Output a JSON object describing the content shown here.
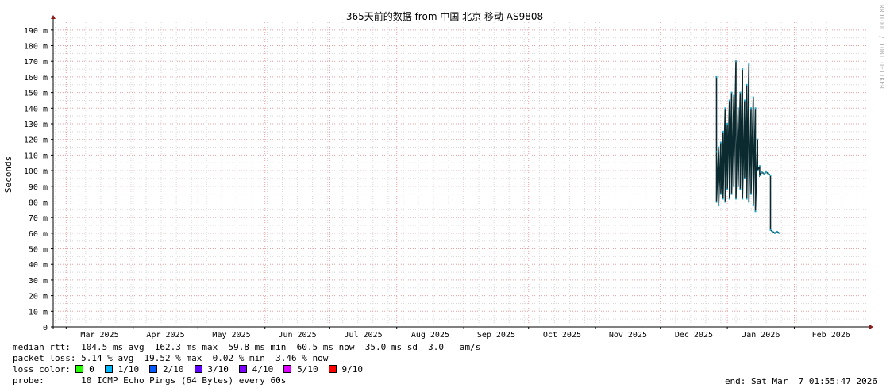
{
  "chart_data": {
    "type": "line",
    "title": "365天前的数据 from  中国 北京 移动 AS9808",
    "ylabel": "Seconds",
    "xlabel": "",
    "ylim": [
      0,
      195
    ],
    "yticks": [
      0,
      10,
      20,
      30,
      40,
      50,
      60,
      70,
      80,
      90,
      100,
      110,
      120,
      130,
      140,
      150,
      160,
      170,
      180,
      190
    ],
    "ytick_labels": [
      "0",
      "10 m",
      "20 m",
      "30 m",
      "40 m",
      "50 m",
      "60 m",
      "70 m",
      "80 m",
      "90 m",
      "100 m",
      "110 m",
      "120 m",
      "130 m",
      "140 m",
      "150 m",
      "160 m",
      "170 m",
      "180 m",
      "190 m"
    ],
    "xlim": [
      "2025-02-23",
      "2026-03-07"
    ],
    "xticks": [
      {
        "date": "2025-03-01",
        "label": "Mar 2025"
      },
      {
        "date": "2025-04-01",
        "label": "Apr 2025"
      },
      {
        "date": "2025-05-01",
        "label": "May 2025"
      },
      {
        "date": "2025-06-01",
        "label": "Jun 2025"
      },
      {
        "date": "2025-07-01",
        "label": "Jul 2025"
      },
      {
        "date": "2025-08-01",
        "label": "Aug 2025"
      },
      {
        "date": "2025-09-01",
        "label": "Sep 2025"
      },
      {
        "date": "2025-10-01",
        "label": "Oct 2025"
      },
      {
        "date": "2025-11-01",
        "label": "Nov 2025"
      },
      {
        "date": "2025-12-01",
        "label": "Dec 2025"
      },
      {
        "date": "2026-01-01",
        "label": "Jan 2026"
      },
      {
        "date": "2026-02-01",
        "label": "Feb 2026"
      }
    ],
    "grid": true,
    "colors": {
      "axis": "#000000",
      "arrow": "#8b1a1a",
      "grid_minor": "#d8d8d8",
      "grid_major": "#e8a0a0",
      "rtt_line": "#000000",
      "loss0": "#26ff00"
    },
    "series": [
      {
        "name": "median rtt",
        "points": [
          [
            "2025-12-27",
            160
          ],
          [
            "2025-12-27",
            112
          ],
          [
            "2025-12-27",
            80
          ],
          [
            "2025-12-28",
            115
          ],
          [
            "2025-12-28",
            78
          ],
          [
            "2025-12-29",
            118
          ],
          [
            "2025-12-29",
            85
          ],
          [
            "2025-12-30",
            125
          ],
          [
            "2025-12-30",
            82
          ],
          [
            "2025-12-31",
            140
          ],
          [
            "2025-12-31",
            80
          ],
          [
            "2026-01-01",
            130
          ],
          [
            "2026-01-01",
            88
          ],
          [
            "2026-01-02",
            145
          ],
          [
            "2026-01-02",
            82
          ],
          [
            "2026-01-03",
            150
          ],
          [
            "2026-01-03",
            85
          ],
          [
            "2026-01-04",
            148
          ],
          [
            "2026-01-04",
            90
          ],
          [
            "2026-01-05",
            170
          ],
          [
            "2026-01-05",
            82
          ],
          [
            "2026-01-06",
            140
          ],
          [
            "2026-01-06",
            90
          ],
          [
            "2026-01-07",
            150
          ],
          [
            "2026-01-07",
            88
          ],
          [
            "2026-01-08",
            165
          ],
          [
            "2026-01-08",
            82
          ],
          [
            "2026-01-09",
            145
          ],
          [
            "2026-01-09",
            95
          ],
          [
            "2026-01-10",
            155
          ],
          [
            "2026-01-10",
            82
          ],
          [
            "2026-01-11",
            168
          ],
          [
            "2026-01-11",
            80
          ],
          [
            "2026-01-12",
            140
          ],
          [
            "2026-01-12",
            85
          ],
          [
            "2026-01-13",
            147
          ],
          [
            "2026-01-13",
            78
          ],
          [
            "2026-01-14",
            140
          ],
          [
            "2026-01-14",
            74
          ],
          [
            "2026-01-15",
            120
          ],
          [
            "2026-01-15",
            100
          ],
          [
            "2026-01-16",
            103
          ],
          [
            "2026-01-16",
            97
          ],
          [
            "2026-01-17",
            99
          ],
          [
            "2026-01-18",
            98
          ],
          [
            "2026-01-19",
            99
          ],
          [
            "2026-01-20",
            98
          ],
          [
            "2026-01-21",
            97
          ],
          [
            "2026-01-21",
            62
          ],
          [
            "2026-01-22",
            61
          ],
          [
            "2026-01-23",
            60
          ],
          [
            "2026-01-24",
            61
          ],
          [
            "2026-01-25",
            60
          ]
        ]
      }
    ]
  },
  "legend": {
    "median_rtt": "median rtt:  104.5 ms avg  162.3 ms max  59.8 ms min  60.5 ms now  35.0 ms sd  3.0   am/s",
    "packet_loss": "packet loss: 5.14 % avg  19.52 % max  0.02 % min  3.46 % now",
    "loss_color_label": "loss color:",
    "loss_colors": [
      {
        "label": "0",
        "color": "#26ff00"
      },
      {
        "label": "1/10",
        "color": "#00b8ff"
      },
      {
        "label": "2/10",
        "color": "#0059ff"
      },
      {
        "label": "3/10",
        "color": "#5e00ff"
      },
      {
        "label": "4/10",
        "color": "#7e00ff"
      },
      {
        "label": "5/10",
        "color": "#dd00ff"
      },
      {
        "label": "9/10",
        "color": "#ff0000"
      }
    ],
    "probe": "probe:       10 ICMP Echo Pings (64 Bytes) every 60s",
    "end": "end: Sat Mar  7 01:55:47 2026"
  },
  "watermark": "RRDTOOL / TOBI OETIKER"
}
